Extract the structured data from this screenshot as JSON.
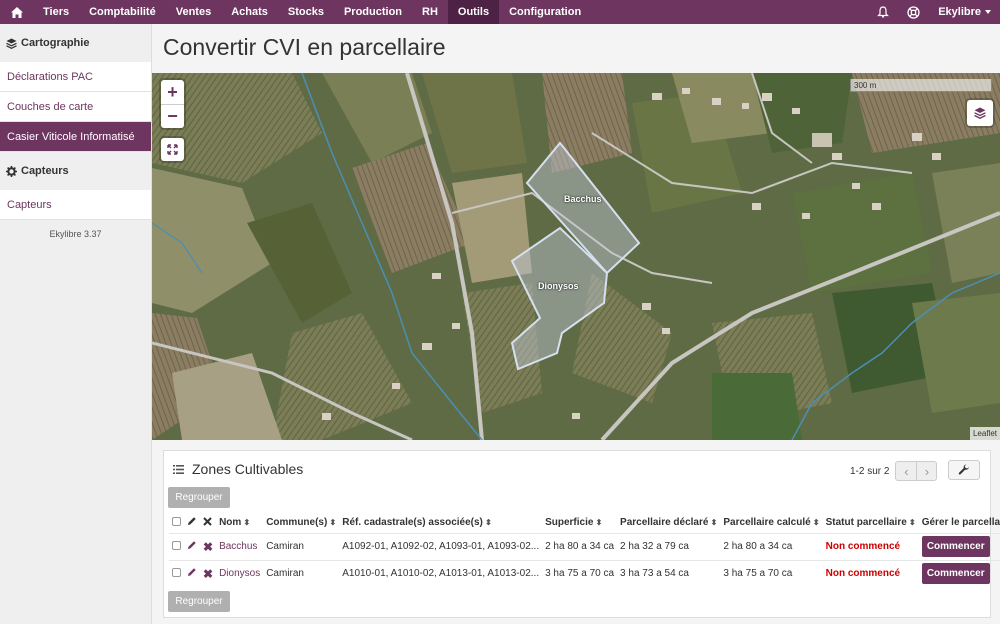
{
  "nav": {
    "items": [
      {
        "label": "Tiers",
        "name": "nav-tiers"
      },
      {
        "label": "Comptabilité",
        "name": "nav-comptabilite"
      },
      {
        "label": "Ventes",
        "name": "nav-ventes"
      },
      {
        "label": "Achats",
        "name": "nav-achats"
      },
      {
        "label": "Stocks",
        "name": "nav-stocks"
      },
      {
        "label": "Production",
        "name": "nav-production"
      },
      {
        "label": "RH",
        "name": "nav-rh"
      },
      {
        "label": "Outils",
        "name": "nav-outils"
      },
      {
        "label": "Configuration",
        "name": "nav-configuration"
      }
    ],
    "active": "Outils",
    "user_label": "Ekylibre"
  },
  "sidebar": {
    "section1": "Cartographie",
    "items1": [
      "Déclarations PAC",
      "Couches de carte",
      "Casier Viticole Informatisé"
    ],
    "active": "Casier Viticole Informatisé",
    "section2": "Capteurs",
    "items2": [
      "Capteurs"
    ],
    "version": "Ekylibre 3.37"
  },
  "page": {
    "title": "Convertir CVI en parcellaire"
  },
  "map": {
    "scale": "300 m",
    "attribution": "Leaflet",
    "parcels": [
      "Bacchus",
      "Dionysos"
    ]
  },
  "panel": {
    "title": "Zones Cultivables",
    "pager": "1-2 sur 2",
    "regroup_label": "Regrouper",
    "columns": [
      "Nom",
      "Commune(s)",
      "Réf. cadastrale(s) associée(s)",
      "Superficie",
      "Parcellaire déclaré",
      "Parcellaire calculé",
      "Statut parcellaire",
      "Gérer le parcellaire"
    ],
    "rows": [
      {
        "nom": "Bacchus",
        "commune": "Camiran",
        "ref": "A1092-01, A1092-02, A1093-01, A1093-02...",
        "superficie": "2 ha 80 a 34 ca",
        "declare": "2 ha 32 a 79 ca",
        "calcule": "2 ha 80 a 34 ca",
        "statut": "Non commencé",
        "action": "Commencer"
      },
      {
        "nom": "Dionysos",
        "commune": "Camiran",
        "ref": "A1010-01, A1010-02, A1013-01, A1013-02...",
        "superficie": "3 ha 75 a 70 ca",
        "declare": "3 ha 73 a 54 ca",
        "calcule": "3 ha 75 a 70 ca",
        "statut": "Non commencé",
        "action": "Commencer"
      }
    ]
  },
  "colors": {
    "brand": "#6d3560",
    "status_not_started": "#cc0000"
  }
}
